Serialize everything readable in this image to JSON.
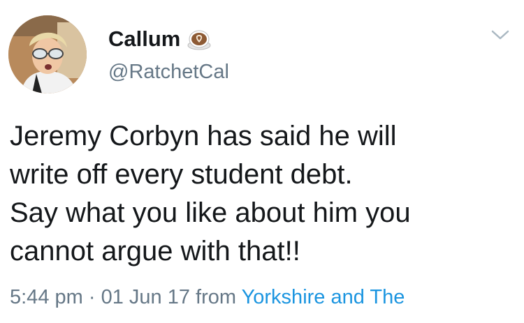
{
  "user": {
    "display_name": "Callum",
    "handle": "@RatchetCal",
    "badge_icon": "latte-art-coffee-icon"
  },
  "tweet": {
    "text": "Jeremy Corbyn has said he will\nwrite off every student debt.\nSay what you like about him you\ncannot argue with that!!",
    "time": "5:44 pm",
    "separator": "·",
    "date": "01 Jun 17",
    "from_label": "from",
    "location": "Yorkshire and The"
  },
  "colors": {
    "text": "#14171a",
    "secondary": "#657786",
    "link": "#1b95e0"
  }
}
